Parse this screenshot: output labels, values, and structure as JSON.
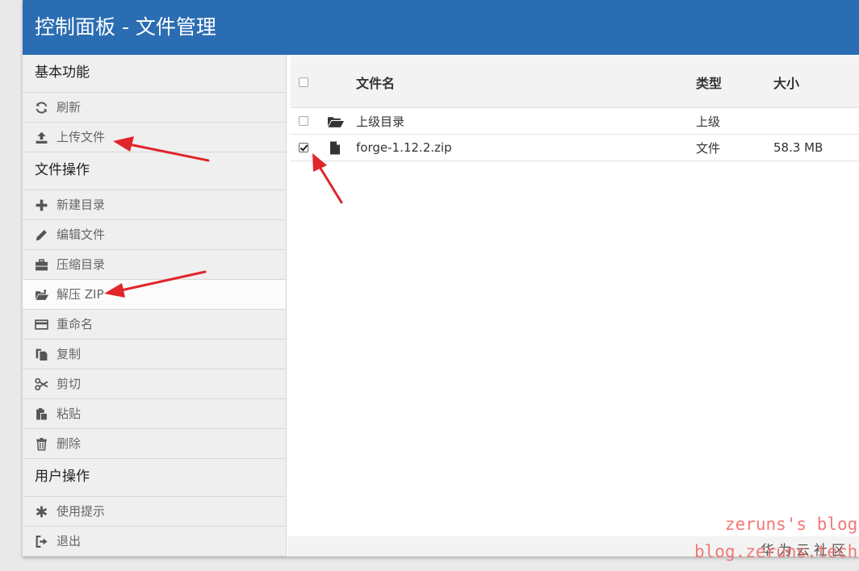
{
  "header": {
    "title": "控制面板 - 文件管理"
  },
  "sidebar": {
    "sections": [
      {
        "title": "基本功能",
        "items": [
          {
            "label": "刷新",
            "icon": "refresh-icon"
          },
          {
            "label": "上传文件",
            "icon": "upload-icon"
          }
        ]
      },
      {
        "title": "文件操作",
        "items": [
          {
            "label": "新建目录",
            "icon": "plus-icon"
          },
          {
            "label": "编辑文件",
            "icon": "pencil-icon"
          },
          {
            "label": "压缩目录",
            "icon": "briefcase-icon"
          },
          {
            "label": "解压 ZIP",
            "icon": "folder-open-icon"
          },
          {
            "label": "重命名",
            "icon": "credit-card-icon"
          },
          {
            "label": "复制",
            "icon": "copy-icon"
          },
          {
            "label": "剪切",
            "icon": "scissors-icon"
          },
          {
            "label": "粘贴",
            "icon": "paste-icon"
          },
          {
            "label": "删除",
            "icon": "trash-icon"
          }
        ]
      },
      {
        "title": "用户操作",
        "items": [
          {
            "label": "使用提示",
            "icon": "asterisk-icon"
          },
          {
            "label": "退出",
            "icon": "logout-icon"
          }
        ]
      }
    ]
  },
  "table": {
    "columns": [
      "文件名",
      "类型",
      "大小"
    ],
    "rows": [
      {
        "name": "上级目录",
        "type": "上级",
        "size": "",
        "checked": false,
        "icon": "folder-open-icon"
      },
      {
        "name": "forge-1.12.2.zip",
        "type": "文件",
        "size": "58.3 MB",
        "checked": true,
        "icon": "file-icon"
      }
    ]
  },
  "footer": {
    "text": "华为云社区"
  },
  "watermark": {
    "line1": "zeruns's blog",
    "line2": "blog.zeruns.tech"
  },
  "colors": {
    "header_bg": "#2b6db2",
    "sidebar_bg": "#efefef",
    "arrow": "#e0252b",
    "watermark": "#f26a6a"
  }
}
